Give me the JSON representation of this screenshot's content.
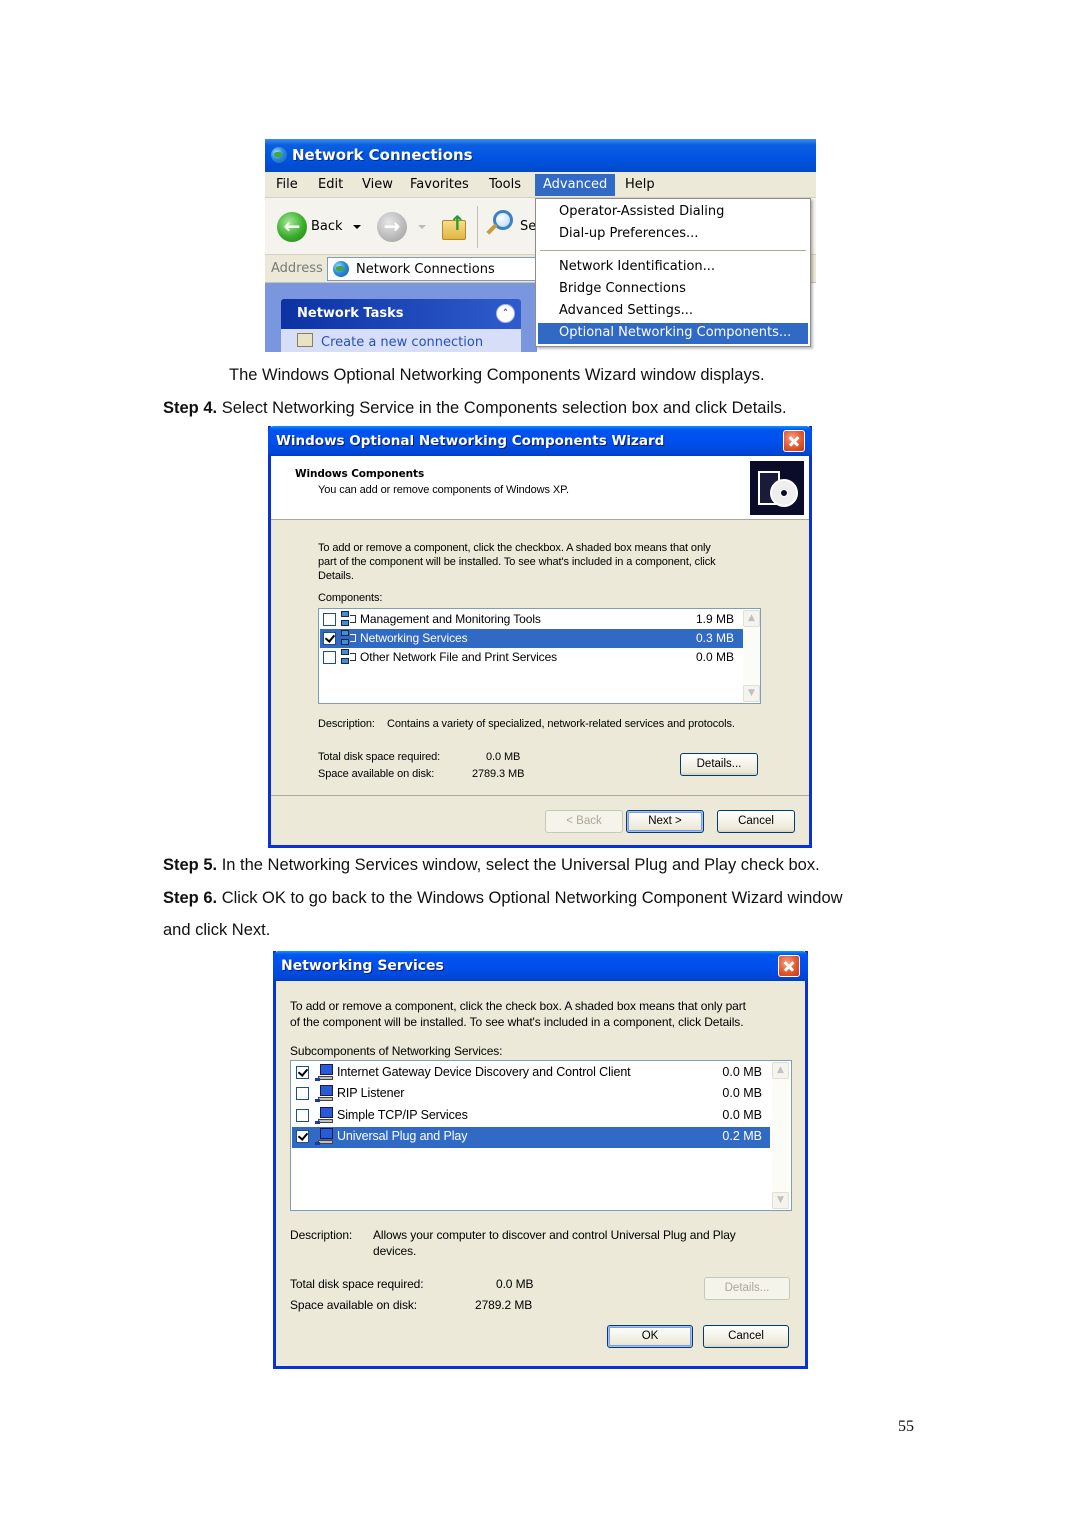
{
  "document": {
    "caption_line": "The Windows Optional Networking Components Wizard window displays.",
    "steps": [
      {
        "label": "Step 4.",
        "text": " Select Networking Service in the Components selection box and click Details."
      },
      {
        "label": "Step 5.",
        "text": " In the Networking Services window, select the Universal Plug and Play check box."
      },
      {
        "label": "Step 6.",
        "text": " Click OK to go back to the Windows Optional Networking Component Wizard window"
      }
    ],
    "step6_continuation": "and click Next.",
    "page_number": "55"
  },
  "network_connections": {
    "title": "Network Connections",
    "menu": [
      "File",
      "Edit",
      "View",
      "Favorites",
      "Tools",
      "Advanced",
      "Help"
    ],
    "active_menu": "Advanced",
    "toolbar": {
      "back_label": "Back",
      "search_label_partial": "Se"
    },
    "address": {
      "label": "Address",
      "value": "Network Connections"
    },
    "tasks_panel": {
      "title": "Network Tasks",
      "first_item_partial": "Create a new connection"
    },
    "advanced_menu_items": [
      "Operator-Assisted Dialing",
      "Dial-up Preferences...",
      "Network Identification...",
      "Bridge Connections",
      "Advanced Settings...",
      "Optional Networking Components..."
    ],
    "highlighted_item": "Optional Networking Components..."
  },
  "wizard": {
    "title": "Windows Optional Networking Components Wizard",
    "header_title": "Windows Components",
    "header_subtitle": "You can add or remove components of Windows XP.",
    "instructions": [
      "To add or remove a component, click the checkbox.  A shaded box means that only",
      "part of the component will be installed.  To see what's included in a component, click",
      "Details."
    ],
    "components_label": "Components:",
    "components": [
      {
        "name": "Management and Monitoring Tools",
        "size": "1.9 MB",
        "checked": false,
        "selected": false
      },
      {
        "name": "Networking Services",
        "size": "0.3 MB",
        "checked": true,
        "selected": true
      },
      {
        "name": "Other Network File and Print Services",
        "size": "0.0 MB",
        "checked": false,
        "selected": false
      }
    ],
    "description_label": "Description:",
    "description": "Contains a variety of specialized, network-related services and protocols.",
    "total_required_label": "Total disk space required:",
    "total_required_value": "0.0 MB",
    "space_available_label": "Space available on disk:",
    "space_available_value": "2789.3 MB",
    "buttons": {
      "details": "Details...",
      "back": "< Back",
      "next": "Next >",
      "cancel": "Cancel"
    }
  },
  "networking_services": {
    "title": "Networking Services",
    "instructions": [
      "To add or remove a component, click the check box. A shaded box means that only part",
      "of the component will be installed. To see what's included in a component, click Details."
    ],
    "subcomponents_label": "Subcomponents of Networking Services:",
    "subcomponents": [
      {
        "name": "Internet Gateway Device Discovery and Control Client",
        "size": "0.0 MB",
        "checked": true,
        "selected": false
      },
      {
        "name": "RIP Listener",
        "size": "0.0 MB",
        "checked": false,
        "selected": false
      },
      {
        "name": "Simple TCP/IP Services",
        "size": "0.0 MB",
        "checked": false,
        "selected": false
      },
      {
        "name": "Universal Plug and Play",
        "size": "0.2 MB",
        "checked": true,
        "selected": true
      }
    ],
    "description_label": "Description:",
    "description_lines": [
      "Allows your computer to discover and control Universal Plug and Play",
      "devices."
    ],
    "total_required_label": "Total disk space required:",
    "total_required_value": "0.0 MB",
    "space_available_label": "Space available on disk:",
    "space_available_value": "2789.2 MB",
    "buttons": {
      "details": "Details...",
      "ok": "OK",
      "cancel": "Cancel"
    }
  }
}
